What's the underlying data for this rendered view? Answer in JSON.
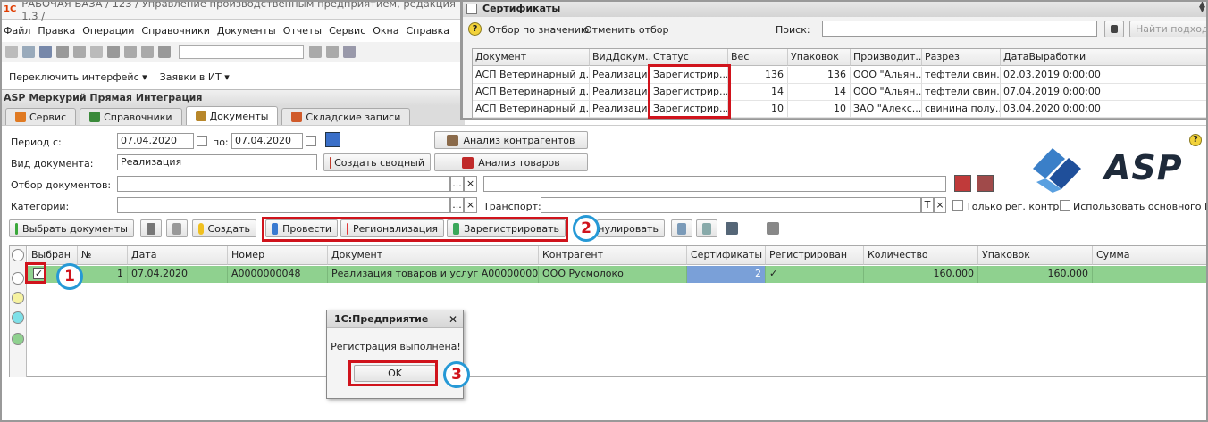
{
  "window": {
    "title": "РАБОЧАЯ БАЗА / 123 / Управление производственным предприятием, редакция 1.3 /",
    "logo_text": "1С",
    "menu": [
      "Файл",
      "Правка",
      "Операции",
      "Справочники",
      "Документы",
      "Отчеты",
      "Сервис",
      "Окна",
      "Справка"
    ],
    "toolbar2": {
      "switch_interface": "Переключить интерфейс ▾",
      "it_requests": "Заявки в ИТ ▾"
    },
    "app_title": "ASP Меркурий Прямая Интеграция",
    "tabs": [
      {
        "label": "Сервис",
        "color": "#e07a22"
      },
      {
        "label": "Справочники",
        "color": "#3a8a3a"
      },
      {
        "label": "Документы",
        "color": "#b8872a"
      },
      {
        "label": "Складские записи",
        "color": "#d05a2a"
      }
    ],
    "active_tab": 2
  },
  "filters": {
    "period_label": "Период с:",
    "period_from": "07.04.2020",
    "period_to_label": "по:",
    "period_to": "07.04.2020",
    "doc_type_label": "Вид документа:",
    "doc_type": "Реализация",
    "doc_filter_label": "Отбор документов:",
    "categories_label": "Категории:",
    "transport_label": "Транспорт:",
    "only_reg_label": "Только рег. контр",
    "use_main_label": "Использовать основного ВВ",
    "btn_analysis_contractors": "Анализ контрагентов",
    "btn_create_summary": "Создать сводный",
    "btn_analysis_goods": "Анализ товаров",
    "clear_glyph": "×",
    "text_glyph": "T",
    "dots_glyph": "..."
  },
  "actions": {
    "select_docs": "Выбрать документы",
    "create": "Создать",
    "post": "Провести",
    "regionalization": "Регионализация",
    "register": "Зарегистрировать",
    "annul": "нулировать"
  },
  "grid": {
    "columns": [
      "Выбран",
      "№",
      "Дата",
      "Номер",
      "Документ",
      "Контрагент",
      "Сертификаты",
      "Регистрирован",
      "Количество",
      "Упаковок",
      "Сумма"
    ],
    "rows": [
      {
        "selected": "✓",
        "num": "1",
        "date": "07.04.2020",
        "number": "А0000000048",
        "document": "Реализация товаров и услуг А0000000048 ...",
        "contractor": "ООО Русмолоко",
        "certificates": "2",
        "registered": "✓",
        "qty": "160,000",
        "packs": "160,000",
        "sum": ""
      }
    ],
    "row_color": "#8fd18f"
  },
  "certificates": {
    "title": "Сертификаты",
    "btn_filter_value": "Отбор по значению",
    "btn_cancel_filter": "Отменить отбор",
    "search_label": "Поиск:",
    "btn_find_next": "Найти подходя",
    "columns": [
      "Документ",
      "ВидДокум...",
      "Статус",
      "Вес",
      "Упаковок",
      "Производит...",
      "Разрез",
      "ДатаВыработки"
    ],
    "rows": [
      [
        "АСП Ветеринарный д...",
        "Реализация",
        "Зарегистрир...",
        "136",
        "136",
        "ООО \"Альян...",
        "тефтели свин...",
        "02.03.2019 0:00:00"
      ],
      [
        "АСП Ветеринарный д...",
        "Реализация",
        "Зарегистрир...",
        "14",
        "14",
        "ООО \"Альян...",
        "тефтели свин...",
        "07.04.2019 0:00:00"
      ],
      [
        "АСП Ветеринарный д...",
        "Реализация",
        "Зарегистрир...",
        "10",
        "10",
        "ЗАО \"Алекс...",
        "свинина полу...",
        "03.04.2020 0:00:00"
      ]
    ]
  },
  "dialog": {
    "title": "1С:Предприятие",
    "message": "Регистрация выполнена!",
    "ok": "OK",
    "close_glyph": "✕"
  },
  "annotations": {
    "step1": "1",
    "step2": "2",
    "step3": "3",
    "highlight_color": "#d0131c",
    "circle_color": "#2699d6"
  },
  "brand": {
    "logo_text": "ASP",
    "help_glyph": "?"
  }
}
